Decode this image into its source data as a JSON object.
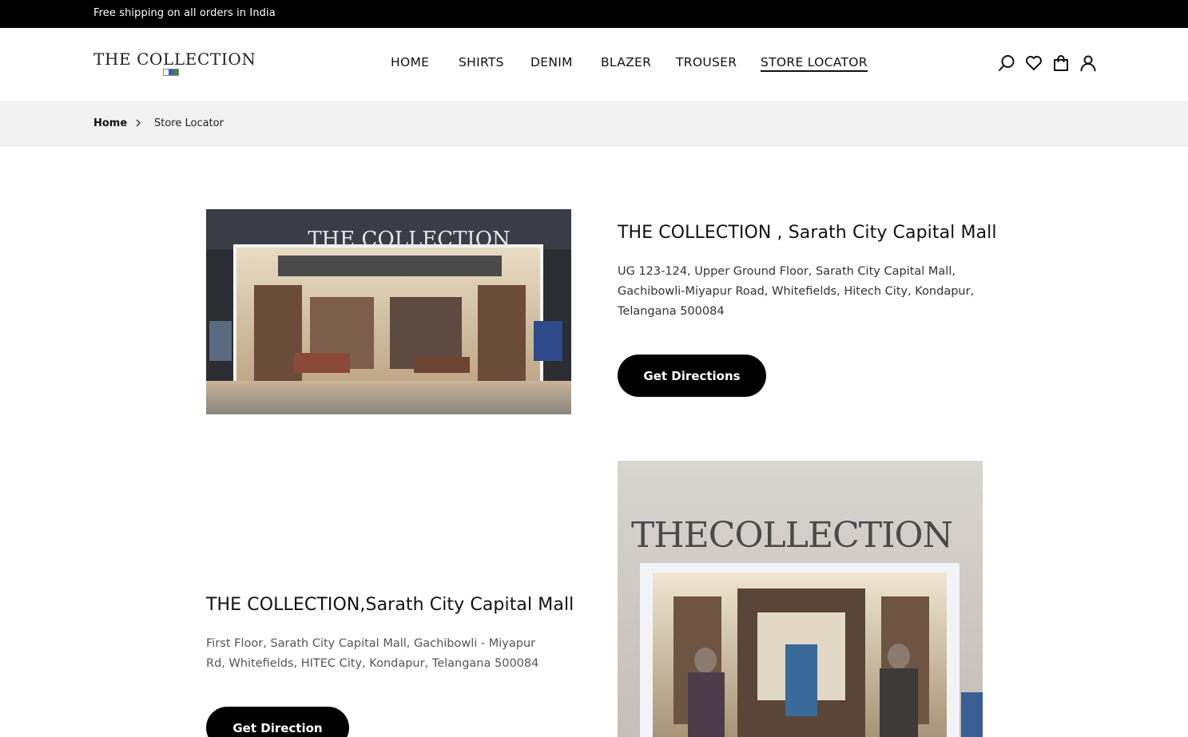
{
  "announcement": {
    "text": "Free shipping on all orders in India"
  },
  "brand": {
    "logo_text": "THE COLLECTION",
    "flag_colors": [
      "#ffffff",
      "#3a5fb0",
      "#3f8a3f"
    ]
  },
  "nav": {
    "items": [
      {
        "label": "HOME",
        "active": false
      },
      {
        "label": "SHIRTS",
        "active": false
      },
      {
        "label": "DENIM",
        "active": false
      },
      {
        "label": "BLAZER",
        "active": false
      },
      {
        "label": "TROUSER",
        "active": false
      },
      {
        "label": "STORE LOCATOR",
        "active": true
      }
    ]
  },
  "header_icons": [
    "search-icon",
    "heart-icon",
    "bag-icon",
    "user-icon"
  ],
  "breadcrumb": {
    "home": "Home",
    "separator_icon": "chevron-right-icon",
    "current": "Store Locator"
  },
  "stores": [
    {
      "title": "THE COLLECTION , Sarath City Capital Mall",
      "address": "UG 123-124, Upper Ground Floor, Sarath City Capital Mall, Gachibowli-Miyapur Road, Whitefields, Hitech City, Kondapur, Telangana 500084",
      "button_label": "Get Directions",
      "image_sign": "THE COLLECTION"
    },
    {
      "title": "THE COLLECTION,Sarath City Capital Mall",
      "address": "First Floor, Sarath City Capital Mall, Gachibowli - Miyapur Rd, Whitefields, HITEC City, Kondapur, Telangana 500084",
      "button_label": "Get Direction",
      "image_sign": "THECOLLECTION"
    }
  ],
  "colors": {
    "topbar": "#000000",
    "breadcrumb_bg": "#f2f2f2",
    "button": "#000000",
    "button_text": "#ffffff"
  }
}
